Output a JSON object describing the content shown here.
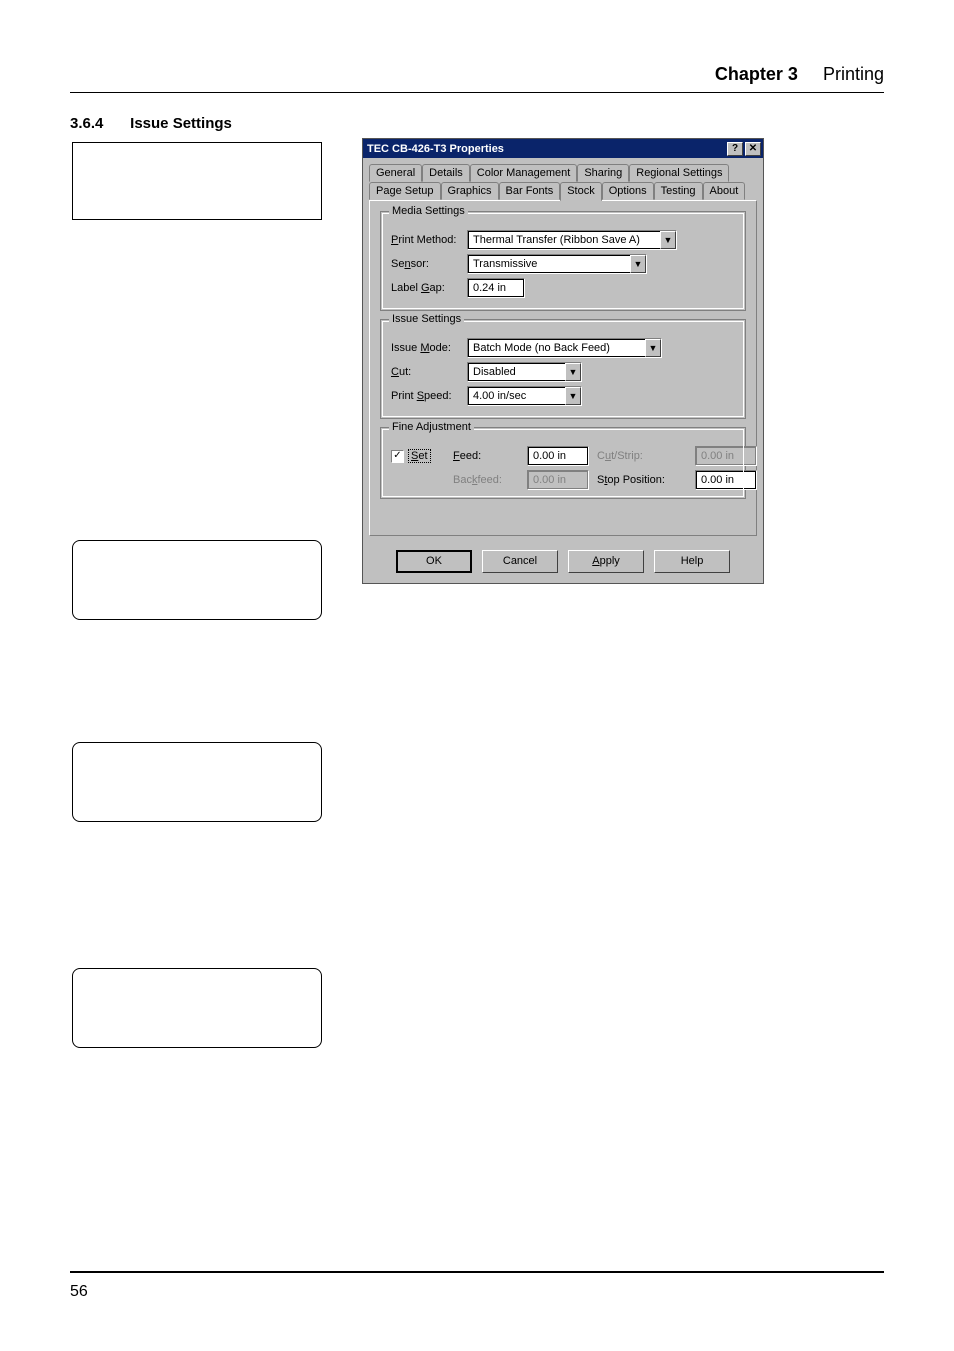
{
  "header": {
    "chapter_label": "Chapter 3",
    "chapter_title": "Printing"
  },
  "section": {
    "number": "3.6.4",
    "title": "Issue Settings"
  },
  "dialog": {
    "title": "TEC CB-426-T3 Properties",
    "help_btn": "?",
    "close_btn": "✕",
    "tabs_row1": [
      "General",
      "Details",
      "Color Management",
      "Sharing",
      "Regional Settings"
    ],
    "tabs_row2": [
      "Page Setup",
      "Graphics",
      "Bar Fonts",
      "Stock",
      "Options",
      "Testing",
      "About"
    ],
    "active_tab_index_row2": 3,
    "groups": {
      "media": {
        "legend": "Media Settings",
        "print_method_label": "Print Method:",
        "print_method_value": "Thermal Transfer (Ribbon Save A)",
        "sensor_label": "Sensor:",
        "sensor_value": "Transmissive",
        "label_gap_label": "Label Gap:",
        "label_gap_value": "0.24 in"
      },
      "issue": {
        "legend": "Issue Settings",
        "issue_mode_label": "Issue Mode:",
        "issue_mode_value": "Batch Mode (no Back Feed)",
        "cut_label": "Cut:",
        "cut_value": "Disabled",
        "print_speed_label": "Print Speed:",
        "print_speed_value": "4.00 in/sec"
      },
      "fine": {
        "legend": "Fine Adjustment",
        "set_label": "Set",
        "set_checked": "✓",
        "feed_label": "Feed:",
        "feed_value": "0.00 in",
        "cut_strip_label": "Cut/Strip:",
        "cut_strip_value": "0.00 in",
        "backfeed_label": "Backfeed:",
        "backfeed_value": "0.00 in",
        "stop_position_label": "Stop Position:",
        "stop_position_value": "0.00 in"
      }
    },
    "buttons": {
      "ok": "OK",
      "cancel": "Cancel",
      "apply": "Apply",
      "help": "Help"
    }
  },
  "footer": {
    "page_number": "56"
  }
}
